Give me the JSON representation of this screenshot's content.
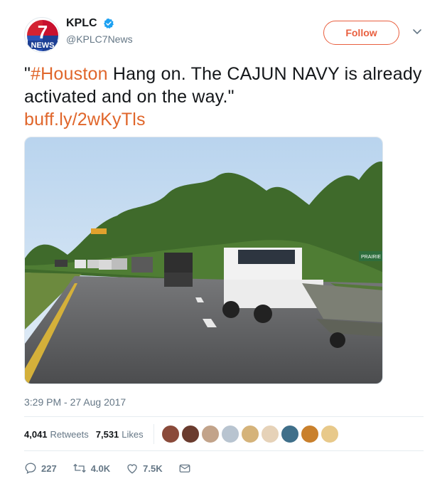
{
  "author": {
    "display_name": "KPLC",
    "handle": "@KPLC7News",
    "verified": true,
    "avatar_text_number": "7",
    "avatar_text_word": "NEWS"
  },
  "follow_label": "Follow",
  "tweet": {
    "quote_open": "\"",
    "hashtag": "#Houston",
    "body": " Hang on. The CAJUN NAVY is already activated and on the way.\"",
    "link": "buff.ly/2wKyTls"
  },
  "media": {
    "sign_text": "PRAIRIE"
  },
  "timestamp": "3:29 PM - 27 Aug 2017",
  "stats": {
    "retweets_count": "4,041",
    "retweets_label": "Retweets",
    "likes_count": "7,531",
    "likes_label": "Likes"
  },
  "actions": {
    "replies": "227",
    "retweets": "4.0K",
    "likes": "7.5K"
  },
  "colors": {
    "accent": "#e95f3f",
    "link": "#e0662b",
    "muted": "#657786",
    "verified_blue": "#1da1f2"
  }
}
